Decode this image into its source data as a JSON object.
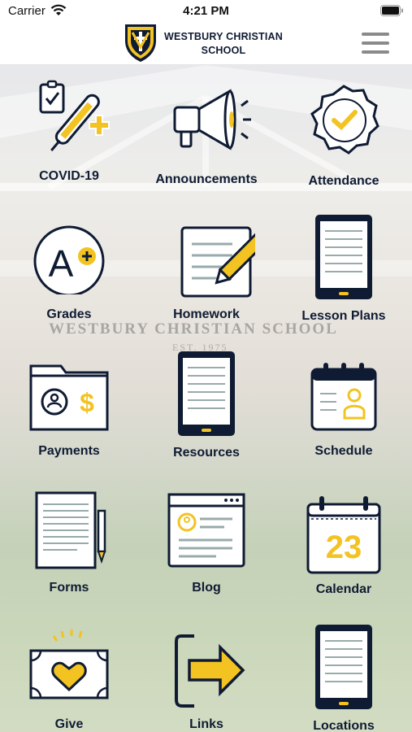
{
  "status_bar": {
    "carrier": "Carrier",
    "time": "4:21 PM"
  },
  "header": {
    "school_name_line1": "WESTBURY CHRISTIAN",
    "school_name_line2": "SCHOOL"
  },
  "background": {
    "sign_text": "WESTBURY CHRISTIAN SCHOOL",
    "sign_subtext": "EST. 1975"
  },
  "colors": {
    "navy": "#0f1b33",
    "gold": "#f3c322",
    "gray": "#8a8a8a"
  },
  "tiles": [
    {
      "label": "COVID-19",
      "icon": "thermometer-icon"
    },
    {
      "label": "Announcements",
      "icon": "megaphone-icon"
    },
    {
      "label": "Attendance",
      "icon": "checkmark-badge-icon"
    },
    {
      "label": "Grades",
      "icon": "a-plus-icon"
    },
    {
      "label": "Homework",
      "icon": "notepad-pencil-icon"
    },
    {
      "label": "Lesson Plans",
      "icon": "tablet-icon"
    },
    {
      "label": "Payments",
      "icon": "wallet-folder-icon"
    },
    {
      "label": "Resources",
      "icon": "tablet-icon"
    },
    {
      "label": "Schedule",
      "icon": "calendar-person-icon"
    },
    {
      "label": "Forms",
      "icon": "document-pencil-icon"
    },
    {
      "label": "Blog",
      "icon": "browser-profile-icon"
    },
    {
      "label": "Calendar",
      "icon": "calendar-icon",
      "day": "23"
    },
    {
      "label": "Give",
      "icon": "heart-money-icon"
    },
    {
      "label": "Links",
      "icon": "arrow-bracket-icon"
    },
    {
      "label": "Locations",
      "icon": "tablet-icon"
    }
  ]
}
